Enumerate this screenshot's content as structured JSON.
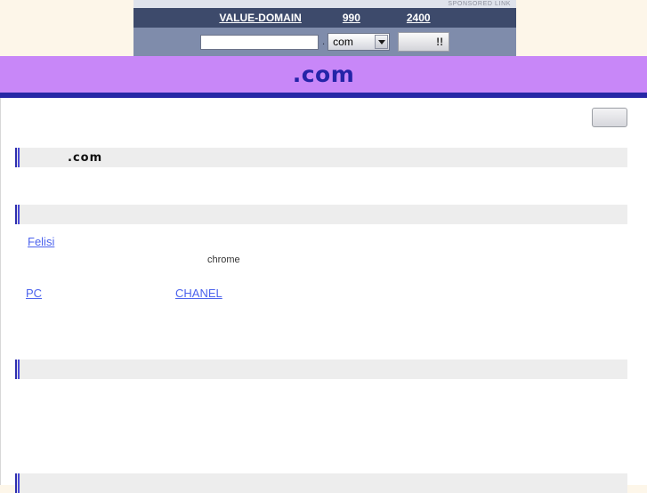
{
  "ad": {
    "sponsored_label": "SPONSORED LINK",
    "title": "VALUE-DOMAIN",
    "price_1": "990",
    "price_2": "2400",
    "search_value": "",
    "search_placeholder": "",
    "dot_separator": ".",
    "tld_selected": "com",
    "tld_options": [
      "com"
    ],
    "submit_label": "!!"
  },
  "header": {
    "title": ".com",
    "accent_purple": "#c887f8",
    "accent_blue": "#2727a6"
  },
  "toolbar": {
    "blank_button_label": ""
  },
  "sections": [
    {
      "id": "section-1",
      "title": ".com"
    },
    {
      "id": "section-2",
      "title": ""
    },
    {
      "id": "section-3",
      "title": ""
    },
    {
      "id": "section-4",
      "title": ""
    }
  ],
  "links": {
    "row1": [
      {
        "label": "Felisi"
      },
      {
        "label": ""
      },
      {
        "label": ""
      },
      {
        "label": ""
      }
    ],
    "row1_note": "chrome",
    "row2": [
      {
        "label": "PC"
      },
      {
        "label": "CHANEL"
      }
    ],
    "row3": [
      {
        "label": ""
      }
    ]
  },
  "colors": {
    "link": "#4c63ed",
    "page_background": "#fdf6e9",
    "content_background": "#ffffff",
    "section_bar": "#ededed",
    "ad_title_bar": "#3d4a6b",
    "ad_body": "#7f8cab"
  }
}
